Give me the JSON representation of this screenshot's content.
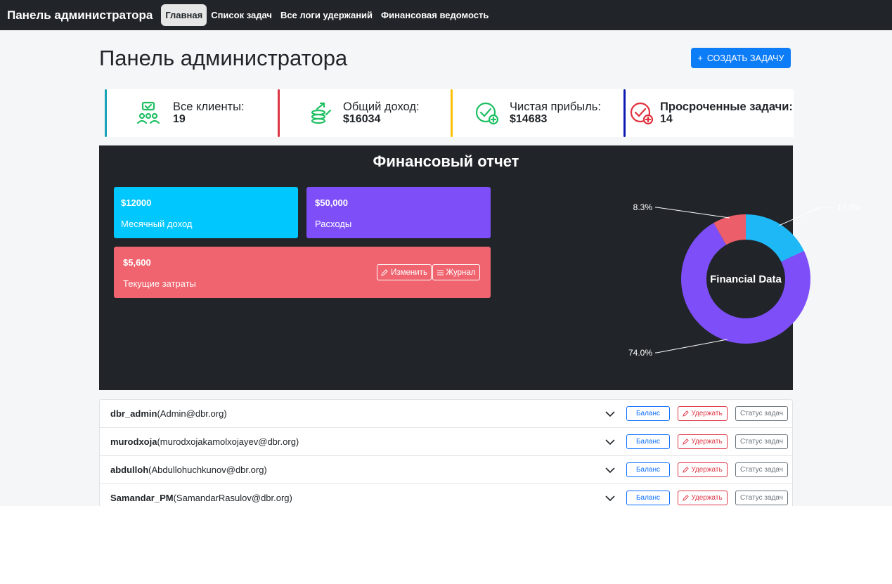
{
  "navbar": {
    "brand": "Панель администратора",
    "links": [
      "Главная",
      "Список задач",
      "Все логи удержаний",
      "Финансовая ведомость"
    ],
    "active_index": 0
  },
  "header": {
    "title": "Панель администратора",
    "create_button": "СОЗДАТЬ ЗАДАЧУ",
    "create_icon": "+"
  },
  "stats": [
    {
      "label": "Все клиенты:",
      "value": "19",
      "color": "#17a2b8",
      "icon": "clients-icon"
    },
    {
      "label": "Общий доход:",
      "value": "$16034",
      "color": "#dc3545",
      "icon": "income-icon"
    },
    {
      "label": "Чистая прибыль:",
      "value": "$14683",
      "color": "#ffc107",
      "icon": "profit-icon"
    },
    {
      "label": "Просроченные задачи:",
      "value": "14",
      "color": "#0d1bb0",
      "icon": "overdue-icon"
    }
  ],
  "finance": {
    "title": "Финансовый отчет",
    "cards": [
      {
        "amount": "$12000",
        "label": "Месячный доход",
        "color": "#00c7fd"
      },
      {
        "amount": "$50,000",
        "label": "Расходы",
        "color": "#7e4ff8"
      },
      {
        "amount": "$5,600",
        "label": "Текущие затраты",
        "color": "#f0646f"
      }
    ],
    "edit_button": "Изменить",
    "log_button": "Журнал"
  },
  "chart_data": {
    "type": "pie",
    "center_label": "Financial Data",
    "slices": [
      {
        "value": 17.8,
        "label": "17.8%",
        "color": "#1fb8f7"
      },
      {
        "value": 74.0,
        "label": "74.0%",
        "color": "#7e4ff8"
      },
      {
        "value": 8.3,
        "label": "8.3%",
        "color": "#ec5e6a"
      }
    ]
  },
  "users": {
    "rows": [
      {
        "login": "dbr_admin",
        "email": "(Admin@dbr.org)"
      },
      {
        "login": "murodxoja",
        "email": "(murodxojakamolxojayev@dbr.org)"
      },
      {
        "login": "abdulloh",
        "email": "(Abdullohuchkunov@dbr.org)"
      },
      {
        "login": "Samandar_PM",
        "email": "(SamandarRasulov@dbr.org)"
      }
    ],
    "balance_label": "Баланс",
    "hold_label": "Удержать",
    "status_label": "Статус задач"
  }
}
